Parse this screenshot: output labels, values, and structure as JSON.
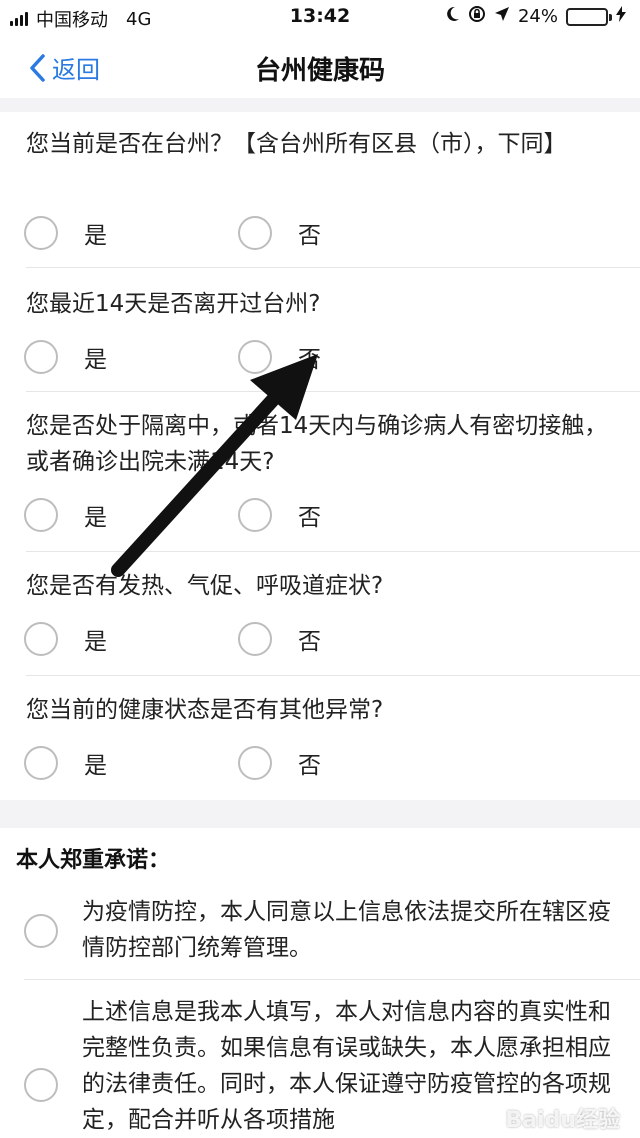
{
  "status_bar": {
    "carrier": "中国移动",
    "network": "4G",
    "time": "13:42",
    "battery": "24%",
    "battery_level": 0.24
  },
  "nav": {
    "back_label": "返回",
    "title": "台州健康码"
  },
  "questions": [
    {
      "text": "您当前是否在台州？【含台州所有区县（市），下同】",
      "yes": "是",
      "no": "否"
    },
    {
      "text": "您最近14天是否离开过台州?",
      "yes": "是",
      "no": "否"
    },
    {
      "text": "您是否处于隔离中，或者14天内与确诊病人有密切接触，或者确诊出院未满14天?",
      "yes": "是",
      "no": "否"
    },
    {
      "text": "您是否有发热、气促、呼吸道症状?",
      "yes": "是",
      "no": "否"
    },
    {
      "text": "您当前的健康状态是否有其他异常?",
      "yes": "是",
      "no": "否"
    }
  ],
  "pledge": {
    "title": "本人郑重承诺：",
    "items": [
      "为疫情防控，本人同意以上信息依法提交所在辖区疫情防控部门统筹管理。",
      "上述信息是我本人填写，本人对信息内容的真实性和完整性负责。如果信息有误或缺失，本人愿承担相应的法律责任。同时，本人保证遵守防疫管控的各项规定，配合并听从各项措施"
    ]
  },
  "watermark": "Baidu经验",
  "colors": {
    "accent": "#2a7ae2",
    "battery": "#3bcd3b",
    "divider": "#f3f3f5"
  }
}
